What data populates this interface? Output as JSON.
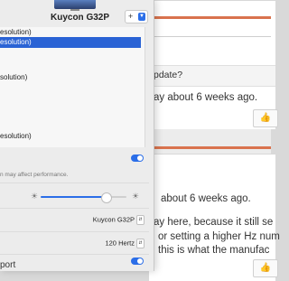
{
  "forum": {
    "line1": "pdate?",
    "line2": "ay about 6 weeks ago.",
    "line3": "about 6 weeks ago.",
    "line4": "ay here, because it still se",
    "line5": "or setting a higher Hz num",
    "line6": "this is what the manufac",
    "like_icon": "thumbs-up-icon"
  },
  "settings": {
    "display_name": "Kuycon G32P",
    "add_label": "+",
    "chevron_icon": "chevron-down-icon",
    "resolutions": [
      {
        "label": "esolution)",
        "selected": false
      },
      {
        "label": "esolution)",
        "selected": true
      },
      {
        "label": "",
        "selected": false
      },
      {
        "label": "",
        "selected": false
      },
      {
        "label": "solution)",
        "selected": false
      },
      {
        "label": "",
        "selected": false
      },
      {
        "label": "",
        "selected": false
      },
      {
        "label": "",
        "selected": false
      },
      {
        "label": "",
        "selected": false
      },
      {
        "label": "esolution)",
        "selected": false
      }
    ],
    "performance_note": "n may affect performance.",
    "hdr_toggle_on": true,
    "brightness_fraction": 0.76,
    "monitor_popup": "Kuycon G32P",
    "refresh_popup": "120 Hertz",
    "bottom_toggle_on": true,
    "bottom_label": "port",
    "accent_color": "#2b6ee8",
    "selection_color": "#2a63d5"
  }
}
